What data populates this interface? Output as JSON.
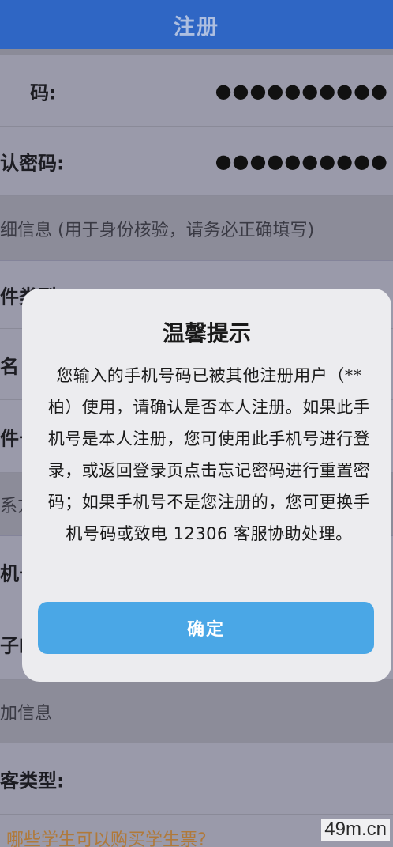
{
  "header": {
    "title": "注册"
  },
  "form": {
    "password_label": "码:",
    "password_value": "●●●●●●●●●●",
    "confirm_label": "认密码:",
    "confirm_value": "●●●●●●●●●●",
    "detail_section": "细信息 (用于身份核验，请务必正确填写)",
    "id_type_label": "件类型",
    "name_label": "名",
    "id_number_label": "件号",
    "contact_section": "系方",
    "mobile_label": "机号",
    "email_label": "子邮",
    "extra_section": "加信息",
    "passenger_type_label": "客类型:",
    "student_link": "哪些学生可以购买学生票?"
  },
  "dialog": {
    "title": "温馨提示",
    "message": "您输入的手机号码已被其他注册用户（**柏）使用，请确认是否本人注册。如果此手机号是本人注册，您可使用此手机号进行登录，或返回登录页点击忘记密码进行重置密码；如果手机号不是您注册的，您可更换手机号码或致电 12306 客服协助处理。",
    "confirm_label": "确定"
  },
  "watermark": "49m.cn",
  "colors": {
    "header": "#2f66c4",
    "confirm_button": "#4aa7e6",
    "link": "#b0793a"
  }
}
